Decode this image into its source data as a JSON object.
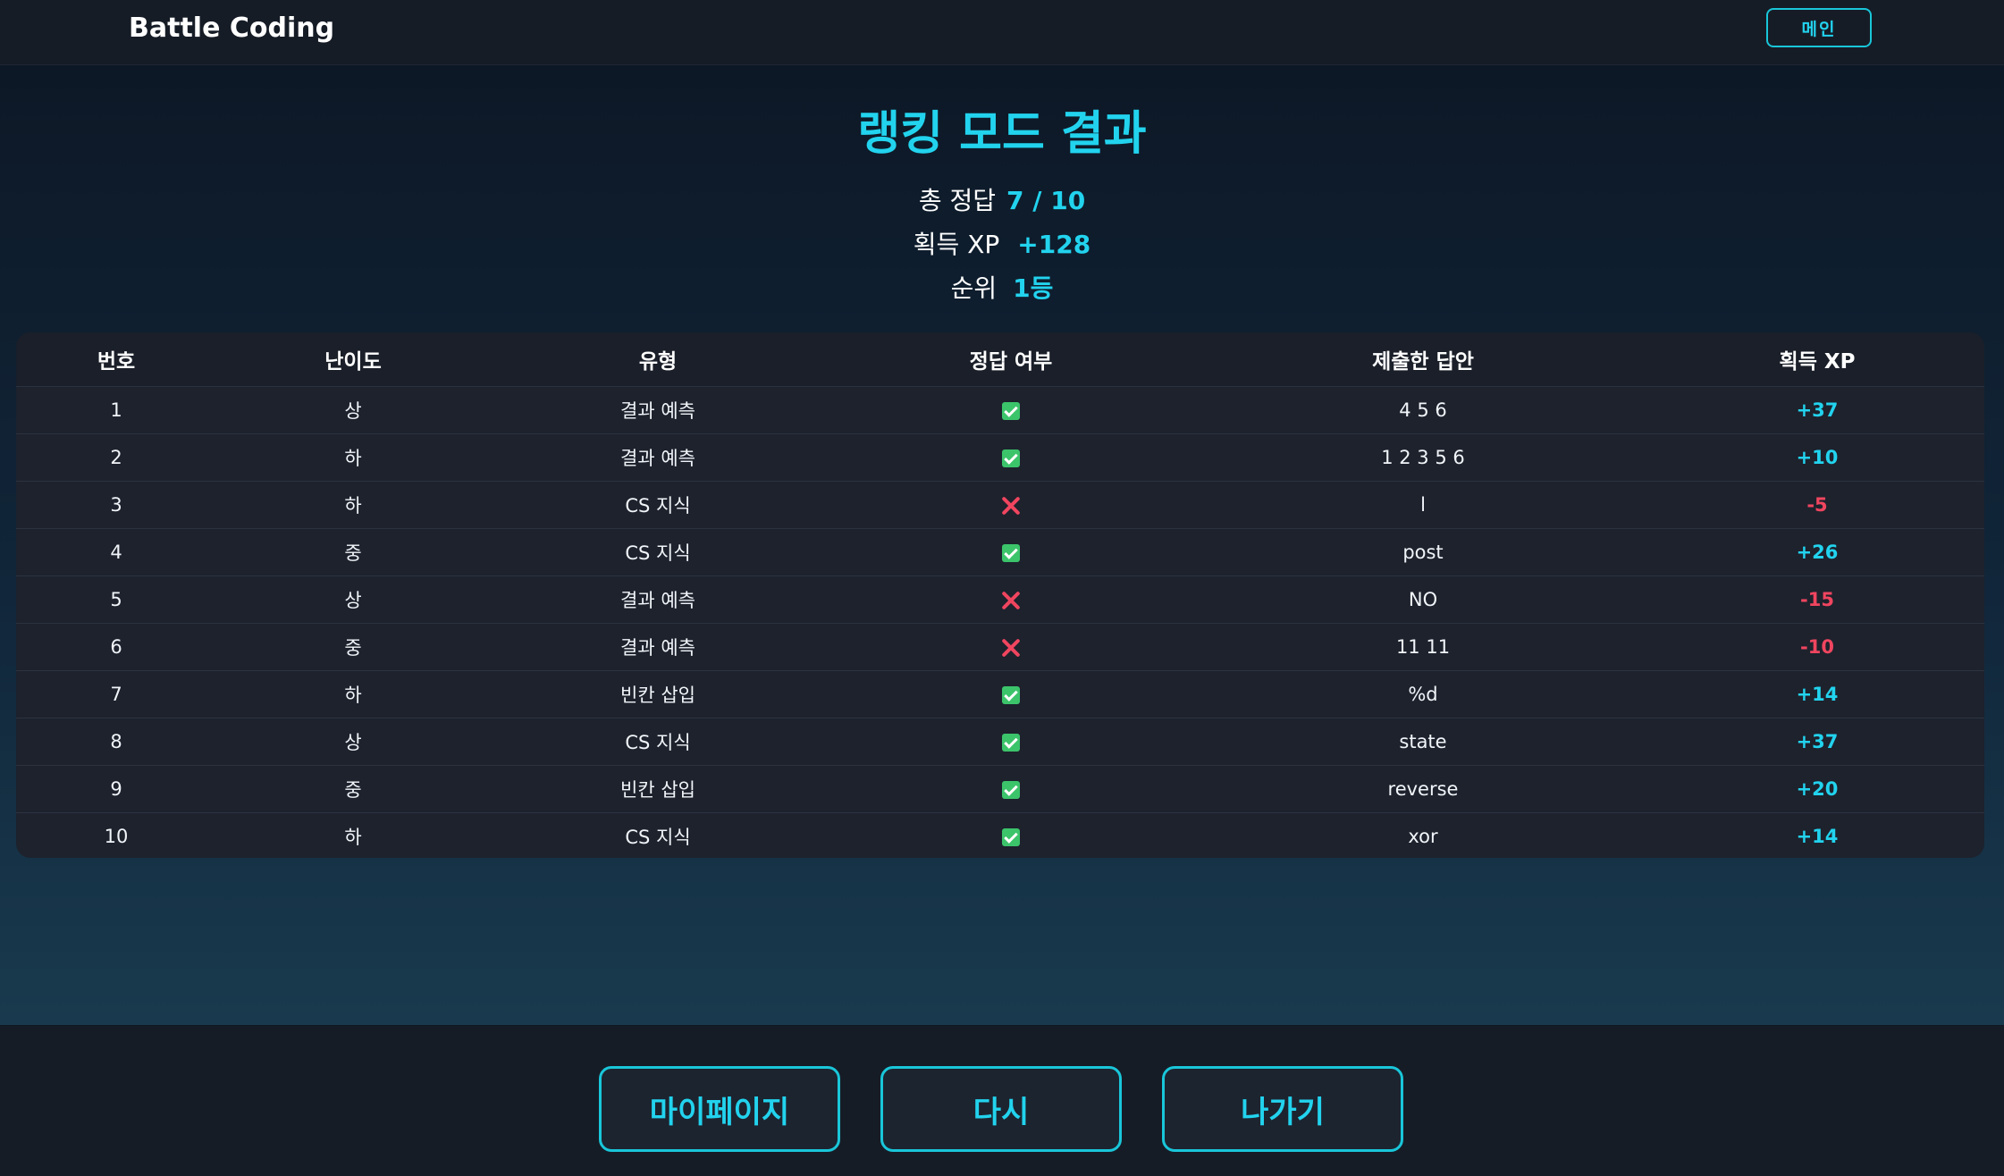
{
  "header": {
    "brand": "Battle Coding",
    "main_button": "메인"
  },
  "result": {
    "title": "랭킹 모드 결과",
    "total_correct_label": "총 정답",
    "total_correct_value": "7 / 10",
    "xp_label": "획득 XP",
    "xp_value": "+128",
    "rank_label": "순위",
    "rank_value": "1등"
  },
  "table": {
    "columns": [
      "번호",
      "난이도",
      "유형",
      "정답 여부",
      "제출한 답안",
      "획득 XP"
    ],
    "rows": [
      {
        "no": "1",
        "difficulty": "상",
        "type": "결과 예측",
        "correct": true,
        "answer": "4 5 6",
        "xp": "+37"
      },
      {
        "no": "2",
        "difficulty": "하",
        "type": "결과 예측",
        "correct": true,
        "answer": "1 2 3 5 6",
        "xp": "+10"
      },
      {
        "no": "3",
        "difficulty": "하",
        "type": "CS 지식",
        "correct": false,
        "answer": "l",
        "xp": "-5"
      },
      {
        "no": "4",
        "difficulty": "중",
        "type": "CS 지식",
        "correct": true,
        "answer": "post",
        "xp": "+26"
      },
      {
        "no": "5",
        "difficulty": "상",
        "type": "결과 예측",
        "correct": false,
        "answer": "NO",
        "xp": "-15"
      },
      {
        "no": "6",
        "difficulty": "중",
        "type": "결과 예측",
        "correct": false,
        "answer": "11 11",
        "xp": "-10"
      },
      {
        "no": "7",
        "difficulty": "하",
        "type": "빈칸 삽입",
        "correct": true,
        "answer": "%d",
        "xp": "+14"
      },
      {
        "no": "8",
        "difficulty": "상",
        "type": "CS 지식",
        "correct": true,
        "answer": "state",
        "xp": "+37"
      },
      {
        "no": "9",
        "difficulty": "중",
        "type": "빈칸 삽입",
        "correct": true,
        "answer": "reverse",
        "xp": "+20"
      },
      {
        "no": "10",
        "difficulty": "하",
        "type": "CS 지식",
        "correct": true,
        "answer": "xor",
        "xp": "+14"
      }
    ]
  },
  "footer": {
    "mypage": "마이페이지",
    "retry": "다시",
    "exit": "나가기"
  },
  "icons": {
    "correct": "check-icon",
    "incorrect": "x-icon"
  },
  "colors": {
    "accent": "#22d3ee",
    "negative": "#f0455f",
    "check": "#3cc46b"
  }
}
